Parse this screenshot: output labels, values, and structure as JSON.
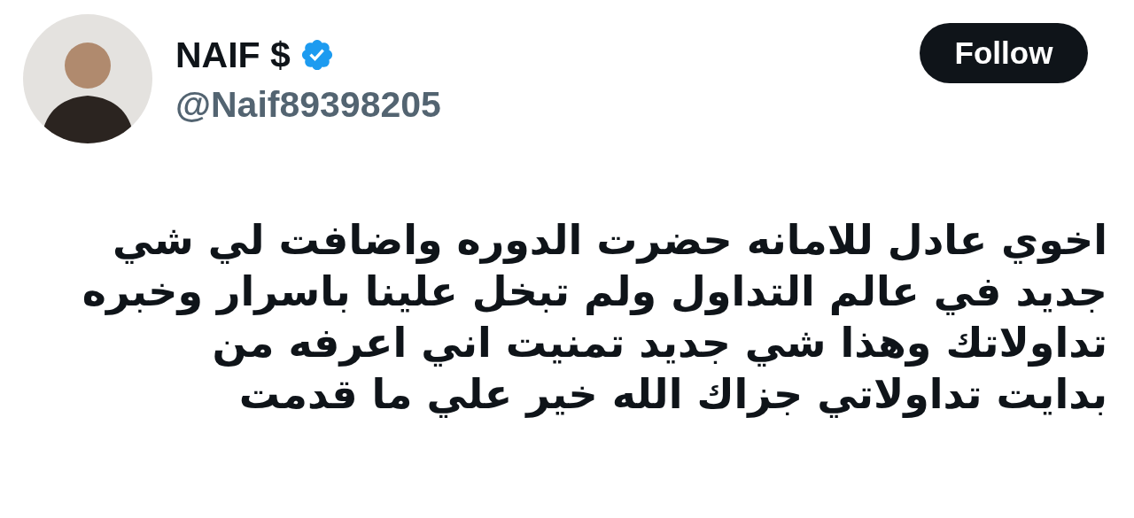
{
  "author": {
    "name": "NAIF $",
    "verified": true,
    "handle": "@Naif89398205"
  },
  "follow_button": {
    "label": "Follow"
  },
  "tweet_lines": [
    "اخوي عادل للامانه حضرت الدوره واضافت لي شي",
    "جديد في عالم التداول ولم تبخل علينا باسرار وخبره",
    "تداولاتك وهذا شي جديد تمنيت اني اعرفه من",
    "بدايت تداولاتي جزاك الله خير علي ما قدمت"
  ]
}
